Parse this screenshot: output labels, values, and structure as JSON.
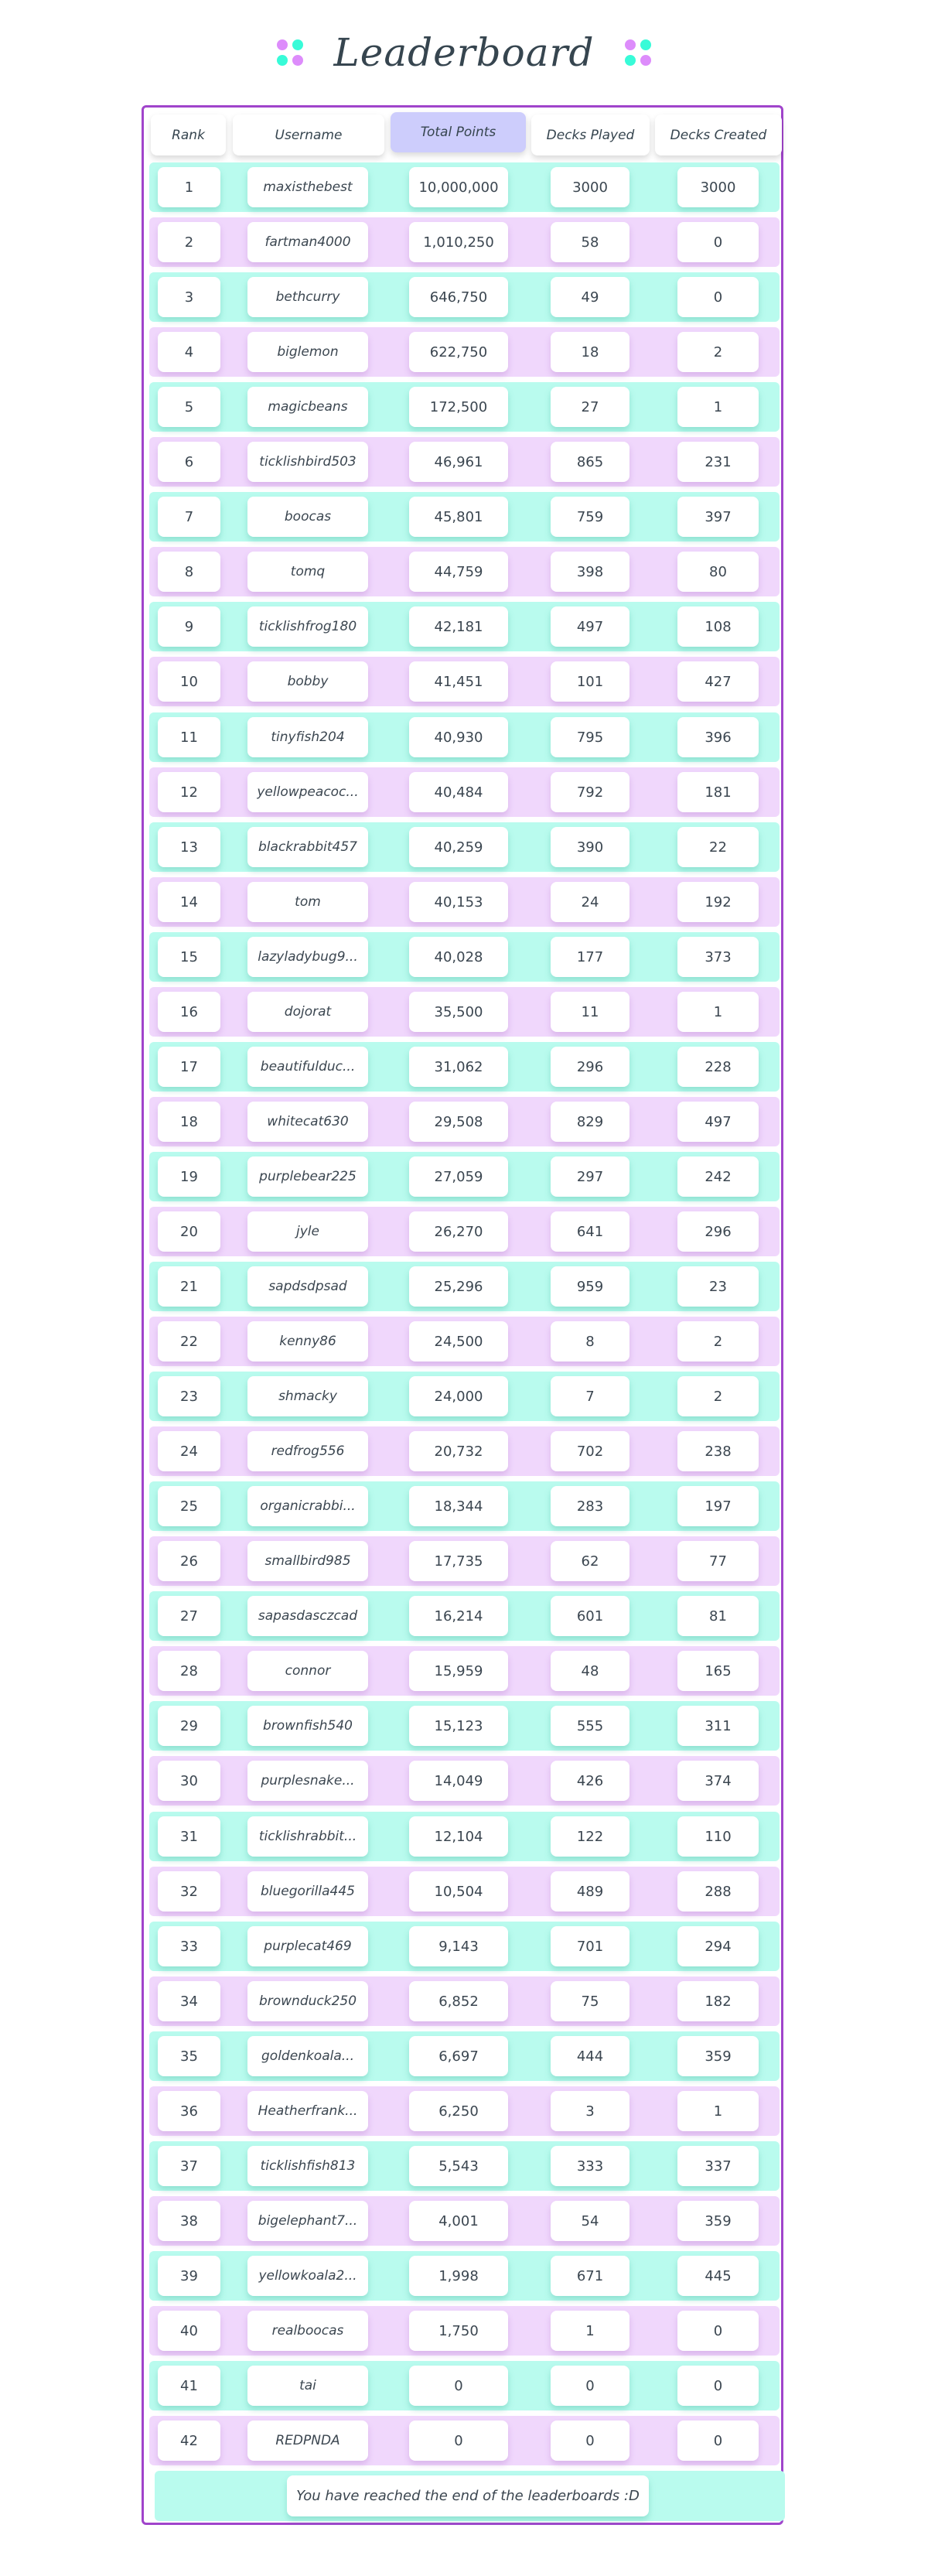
{
  "title": "Leaderboard",
  "colors": {
    "accent_border": "#a044cb",
    "row_teal": "#b9fbee",
    "row_pink": "#f0d7fc",
    "active_header": "#cdcdfc",
    "dot_purple": "#dd8cfb",
    "dot_teal": "#38fbd8"
  },
  "columns": [
    "Rank",
    "Username",
    "Total Points",
    "Decks Played",
    "Decks Created"
  ],
  "sorted_by": "Total Points",
  "rows": [
    {
      "rank": "1",
      "username": "maxisthebest",
      "points": "10,000,000",
      "played": "3000",
      "created": "3000"
    },
    {
      "rank": "2",
      "username": "fartman4000",
      "points": "1,010,250",
      "played": "58",
      "created": "0"
    },
    {
      "rank": "3",
      "username": "bethcurry",
      "points": "646,750",
      "played": "49",
      "created": "0"
    },
    {
      "rank": "4",
      "username": "biglemon",
      "points": "622,750",
      "played": "18",
      "created": "2"
    },
    {
      "rank": "5",
      "username": "magicbeans",
      "points": "172,500",
      "played": "27",
      "created": "1"
    },
    {
      "rank": "6",
      "username": "ticklishbird503",
      "points": "46,961",
      "played": "865",
      "created": "231"
    },
    {
      "rank": "7",
      "username": "boocas",
      "points": "45,801",
      "played": "759",
      "created": "397"
    },
    {
      "rank": "8",
      "username": "tomq",
      "points": "44,759",
      "played": "398",
      "created": "80"
    },
    {
      "rank": "9",
      "username": "ticklishfrog180",
      "points": "42,181",
      "played": "497",
      "created": "108"
    },
    {
      "rank": "10",
      "username": "bobby",
      "points": "41,451",
      "played": "101",
      "created": "427"
    },
    {
      "rank": "11",
      "username": "tinyfish204",
      "points": "40,930",
      "played": "795",
      "created": "396"
    },
    {
      "rank": "12",
      "username": "yellowpeacoc...",
      "points": "40,484",
      "played": "792",
      "created": "181"
    },
    {
      "rank": "13",
      "username": "blackrabbit457",
      "points": "40,259",
      "played": "390",
      "created": "22"
    },
    {
      "rank": "14",
      "username": "tom",
      "points": "40,153",
      "played": "24",
      "created": "192"
    },
    {
      "rank": "15",
      "username": "lazyladybug9...",
      "points": "40,028",
      "played": "177",
      "created": "373"
    },
    {
      "rank": "16",
      "username": "dojorat",
      "points": "35,500",
      "played": "11",
      "created": "1"
    },
    {
      "rank": "17",
      "username": "beautifulduc...",
      "points": "31,062",
      "played": "296",
      "created": "228"
    },
    {
      "rank": "18",
      "username": "whitecat630",
      "points": "29,508",
      "played": "829",
      "created": "497"
    },
    {
      "rank": "19",
      "username": "purplebear225",
      "points": "27,059",
      "played": "297",
      "created": "242"
    },
    {
      "rank": "20",
      "username": "jyle",
      "points": "26,270",
      "played": "641",
      "created": "296"
    },
    {
      "rank": "21",
      "username": "sapdsdpsad",
      "points": "25,296",
      "played": "959",
      "created": "23"
    },
    {
      "rank": "22",
      "username": "kenny86",
      "points": "24,500",
      "played": "8",
      "created": "2"
    },
    {
      "rank": "23",
      "username": "shmacky",
      "points": "24,000",
      "played": "7",
      "created": "2"
    },
    {
      "rank": "24",
      "username": "redfrog556",
      "points": "20,732",
      "played": "702",
      "created": "238"
    },
    {
      "rank": "25",
      "username": "organicrabbi...",
      "points": "18,344",
      "played": "283",
      "created": "197"
    },
    {
      "rank": "26",
      "username": "smallbird985",
      "points": "17,735",
      "played": "62",
      "created": "77"
    },
    {
      "rank": "27",
      "username": "sapasdasczcad",
      "points": "16,214",
      "played": "601",
      "created": "81"
    },
    {
      "rank": "28",
      "username": "connor",
      "points": "15,959",
      "played": "48",
      "created": "165"
    },
    {
      "rank": "29",
      "username": "brownfish540",
      "points": "15,123",
      "played": "555",
      "created": "311"
    },
    {
      "rank": "30",
      "username": "purplesnake...",
      "points": "14,049",
      "played": "426",
      "created": "374"
    },
    {
      "rank": "31",
      "username": "ticklishrabbit...",
      "points": "12,104",
      "played": "122",
      "created": "110"
    },
    {
      "rank": "32",
      "username": "bluegorilla445",
      "points": "10,504",
      "played": "489",
      "created": "288"
    },
    {
      "rank": "33",
      "username": "purplecat469",
      "points": "9,143",
      "played": "701",
      "created": "294"
    },
    {
      "rank": "34",
      "username": "brownduck250",
      "points": "6,852",
      "played": "75",
      "created": "182"
    },
    {
      "rank": "35",
      "username": "goldenkoala...",
      "points": "6,697",
      "played": "444",
      "created": "359"
    },
    {
      "rank": "36",
      "username": "Heatherfrank...",
      "points": "6,250",
      "played": "3",
      "created": "1"
    },
    {
      "rank": "37",
      "username": "ticklishfish813",
      "points": "5,543",
      "played": "333",
      "created": "337"
    },
    {
      "rank": "38",
      "username": "bigelephant7...",
      "points": "4,001",
      "played": "54",
      "created": "359"
    },
    {
      "rank": "39",
      "username": "yellowkoala2...",
      "points": "1,998",
      "played": "671",
      "created": "445"
    },
    {
      "rank": "40",
      "username": "realboocas",
      "points": "1,750",
      "played": "1",
      "created": "0"
    },
    {
      "rank": "41",
      "username": "tai",
      "points": "0",
      "played": "0",
      "created": "0"
    },
    {
      "rank": "42",
      "username": "REDPNDA",
      "points": "0",
      "played": "0",
      "created": "0"
    }
  ],
  "footer_message": "You have reached the end of the leaderboards :D"
}
